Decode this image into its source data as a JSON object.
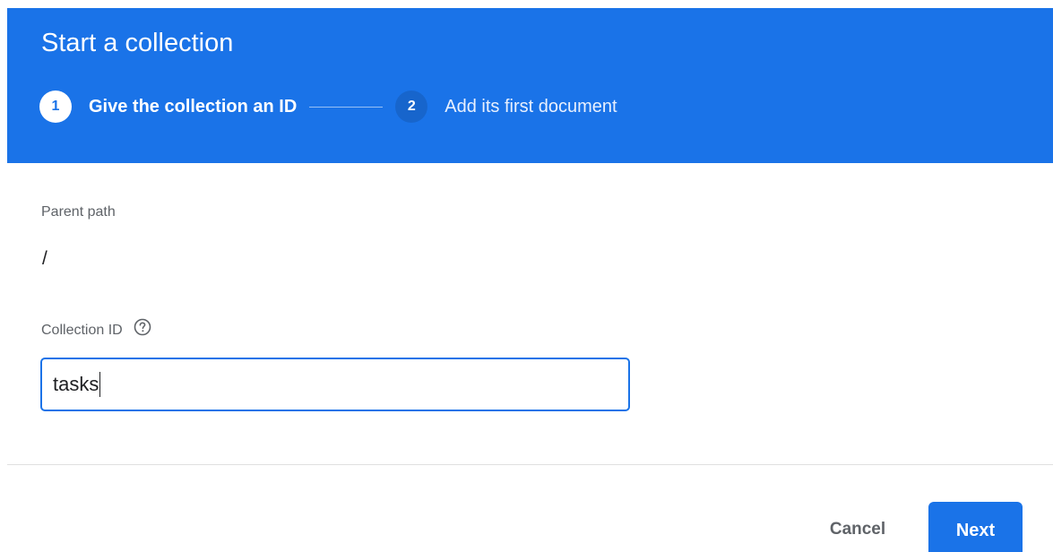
{
  "dialog": {
    "title": "Start a collection",
    "steps": [
      {
        "number": "1",
        "label": "Give the collection an ID"
      },
      {
        "number": "2",
        "label": "Add its first document"
      }
    ],
    "active_step": 1
  },
  "form": {
    "parent_path_label": "Parent path",
    "parent_path_value": "/",
    "collection_id_label": "Collection ID",
    "collection_id_value": "tasks",
    "help_icon": "help-circle-icon"
  },
  "actions": {
    "cancel_label": "Cancel",
    "next_label": "Next"
  },
  "colors": {
    "header_bg": "#1a73e8",
    "accent": "#1a73e8",
    "inactive_step_circle": "#1765cc",
    "label_gray": "#5f6368"
  }
}
